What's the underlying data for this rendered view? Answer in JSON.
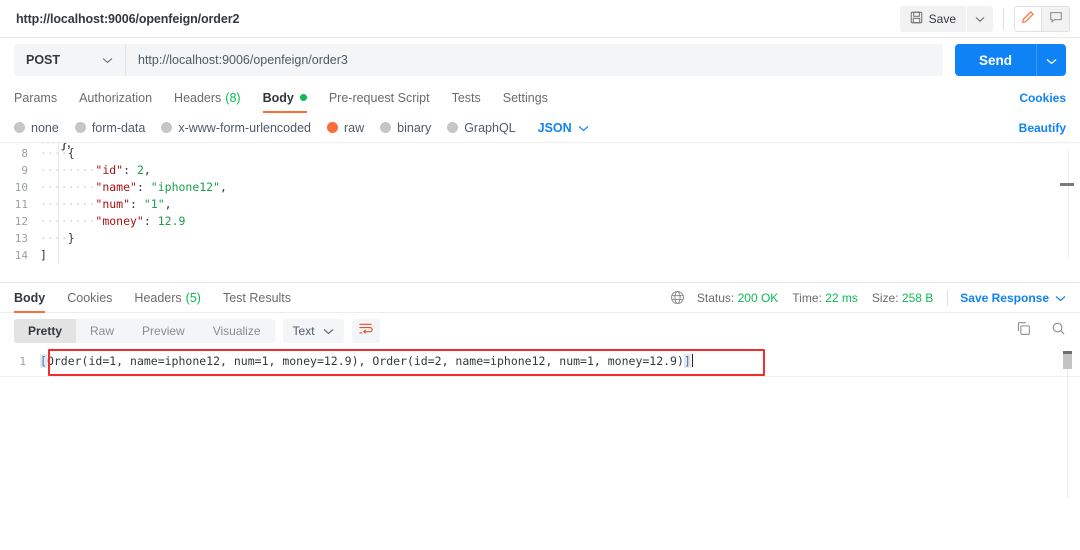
{
  "window": {
    "tab_title": "http://localhost:9006/openfeign/order2"
  },
  "toolbar": {
    "save_label": "Save",
    "save_icon": "floppy-disk-icon",
    "save_caret_icon": "chevron-down-icon",
    "edit_icon": "pencil-icon",
    "comment_icon": "comment-icon"
  },
  "request": {
    "method": "POST",
    "method_caret_icon": "chevron-down-icon",
    "url": "http://localhost:9006/openfeign/order3",
    "send_label": "Send",
    "send_caret_icon": "chevron-down-icon"
  },
  "request_tabs": {
    "items": [
      {
        "label": "Params",
        "active": false
      },
      {
        "label": "Authorization",
        "active": false
      },
      {
        "label": "Headers",
        "count": "(8)",
        "active": false
      },
      {
        "label": "Body",
        "active": true,
        "dot": true
      },
      {
        "label": "Pre-request Script",
        "active": false
      },
      {
        "label": "Tests",
        "active": false
      },
      {
        "label": "Settings",
        "active": false
      }
    ],
    "cookies_label": "Cookies"
  },
  "body_type": {
    "options": [
      {
        "label": "none",
        "selected": false
      },
      {
        "label": "form-data",
        "selected": false
      },
      {
        "label": "x-www-form-urlencoded",
        "selected": false
      },
      {
        "label": "raw",
        "selected": true
      },
      {
        "label": "binary",
        "selected": false
      },
      {
        "label": "GraphQL",
        "selected": false
      }
    ],
    "format": "JSON",
    "format_caret_icon": "chevron-down-icon",
    "beautify_label": "Beautify"
  },
  "editor": {
    "lines": [
      {
        "num": "8",
        "indent": "····",
        "code": "{"
      },
      {
        "num": "9",
        "indent": "········",
        "key": "\"id\"",
        "sep": ": ",
        "value": "2",
        "value_type": "number",
        "trail": ","
      },
      {
        "num": "10",
        "indent": "········",
        "key": "\"name\"",
        "sep": ": ",
        "value": "\"iphone12\"",
        "value_type": "string",
        "trail": ","
      },
      {
        "num": "11",
        "indent": "········",
        "key": "\"num\"",
        "sep": ": ",
        "value": "\"1\"",
        "value_type": "string",
        "trail": ","
      },
      {
        "num": "12",
        "indent": "········",
        "key": "\"money\"",
        "sep": ": ",
        "value": "12.9",
        "value_type": "number",
        "trail": ""
      },
      {
        "num": "13",
        "indent": "····",
        "code": "}"
      },
      {
        "num": "14",
        "indent": "",
        "code": "]"
      }
    ]
  },
  "response_tabs": {
    "items": [
      {
        "label": "Body",
        "active": true
      },
      {
        "label": "Cookies",
        "active": false
      },
      {
        "label": "Headers",
        "count": "(5)",
        "active": false
      },
      {
        "label": "Test Results",
        "active": false
      }
    ]
  },
  "response_status": {
    "globe_icon": "globe-icon",
    "status_label": "Status:",
    "status_value": "200 OK",
    "time_label": "Time:",
    "time_value": "22 ms",
    "size_label": "Size:",
    "size_value": "258 B",
    "save_response_label": "Save Response",
    "save_response_caret_icon": "chevron-down-icon"
  },
  "response_format": {
    "views": [
      {
        "label": "Pretty",
        "active": true
      },
      {
        "label": "Raw",
        "active": false
      },
      {
        "label": "Preview",
        "active": false
      },
      {
        "label": "Visualize",
        "active": false
      }
    ],
    "language": "Text",
    "language_caret_icon": "chevron-down-icon",
    "wrap_icon": "word-wrap-icon",
    "copy_icon": "copy-icon",
    "search_icon": "search-icon"
  },
  "response_body": {
    "line_number": "1",
    "open_bracket": "[",
    "content": "Order(id=1, name=iphone12, num=1, money=12.9), Order(id=2, name=iphone12, num=1, money=12.9)",
    "close_bracket": "]"
  },
  "colors": {
    "accent_orange": "#ff6c37",
    "link_blue": "#0f83f5",
    "success_green": "#0cbb52",
    "highlight_red": "#ef2d2d"
  }
}
